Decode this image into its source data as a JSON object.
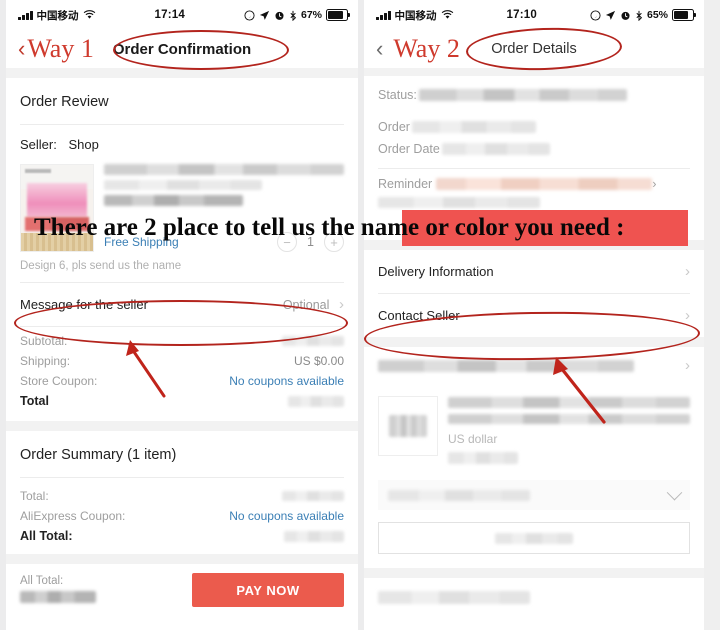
{
  "annotation": {
    "banner_text": "There are 2 place to tell us the name or color you need :",
    "highlight_color": "#ef5350",
    "ink_color": "#b3241d"
  },
  "left_phone": {
    "status_bar": {
      "carrier": "中国移动",
      "time": "17:14",
      "battery": "67%",
      "wifi_icon": "wifi-icon",
      "signal_icon": "signal-bars-icon",
      "location_icon": "location-arrow-icon",
      "alarm_icon": "alarm-clock-icon",
      "bluetooth_icon": "bluetooth-icon",
      "battery_icon": "battery-icon"
    },
    "nav": {
      "way_label": "Way 1",
      "title": "Order Confirmation",
      "back_icon": "chevron-left-icon"
    },
    "section_title": "Order Review",
    "seller_label": "Seller:",
    "seller_name": "Shop",
    "shipping_tag": "Free Shipping",
    "quantity": "1",
    "minus_icon": "minus-icon",
    "plus_icon": "plus-icon",
    "item_note": "Design 6, pls send us the name",
    "message_row": {
      "label": "Message for the seller",
      "value": "Optional",
      "chevron_icon": "chevron-right-icon"
    },
    "price_rows": [
      {
        "label": "Subtotal:",
        "value": "",
        "blurred": true
      },
      {
        "label": "Shipping:",
        "value": "US $0.00",
        "blurred": false
      },
      {
        "label": "Store Coupon:",
        "value": "No coupons available",
        "blurred": false
      },
      {
        "label": "Total",
        "value": "",
        "blurred": true
      }
    ],
    "summary_title": "Order Summary (1 item)",
    "summary_rows": [
      {
        "label": "Total:",
        "value": "",
        "blurred": true
      },
      {
        "label": "AliExpress Coupon:",
        "value": "No coupons available",
        "blurred": false
      },
      {
        "label": "All Total:",
        "value": "",
        "blurred": true
      }
    ],
    "paybar": {
      "total_label": "All Total:",
      "total_value": "",
      "button_label": "PAY NOW",
      "button_color": "#eb5b4d"
    }
  },
  "right_phone": {
    "status_bar": {
      "carrier": "中国移动",
      "time": "17:10",
      "battery": "65%",
      "wifi_icon": "wifi-icon",
      "signal_icon": "signal-bars-icon",
      "location_icon": "location-arrow-icon",
      "alarm_icon": "alarm-clock-icon",
      "bluetooth_icon": "bluetooth-icon",
      "battery_icon": "battery-icon"
    },
    "nav": {
      "way_label": "Way 2",
      "title": "Order Details",
      "back_icon": "chevron-left-icon"
    },
    "info_rows": [
      {
        "label": "Status:"
      },
      {
        "label": "Order"
      },
      {
        "label": "Order Date"
      },
      {
        "label": "Reminder"
      }
    ],
    "menu_rows": [
      {
        "label": "Delivery Information",
        "chevron_icon": "chevron-right-icon"
      },
      {
        "label": "Contact Seller",
        "chevron_icon": "chevron-right-icon"
      }
    ],
    "product": {
      "price_text": "US dollar",
      "select_chevron_icon": "chevron-down-icon"
    }
  }
}
